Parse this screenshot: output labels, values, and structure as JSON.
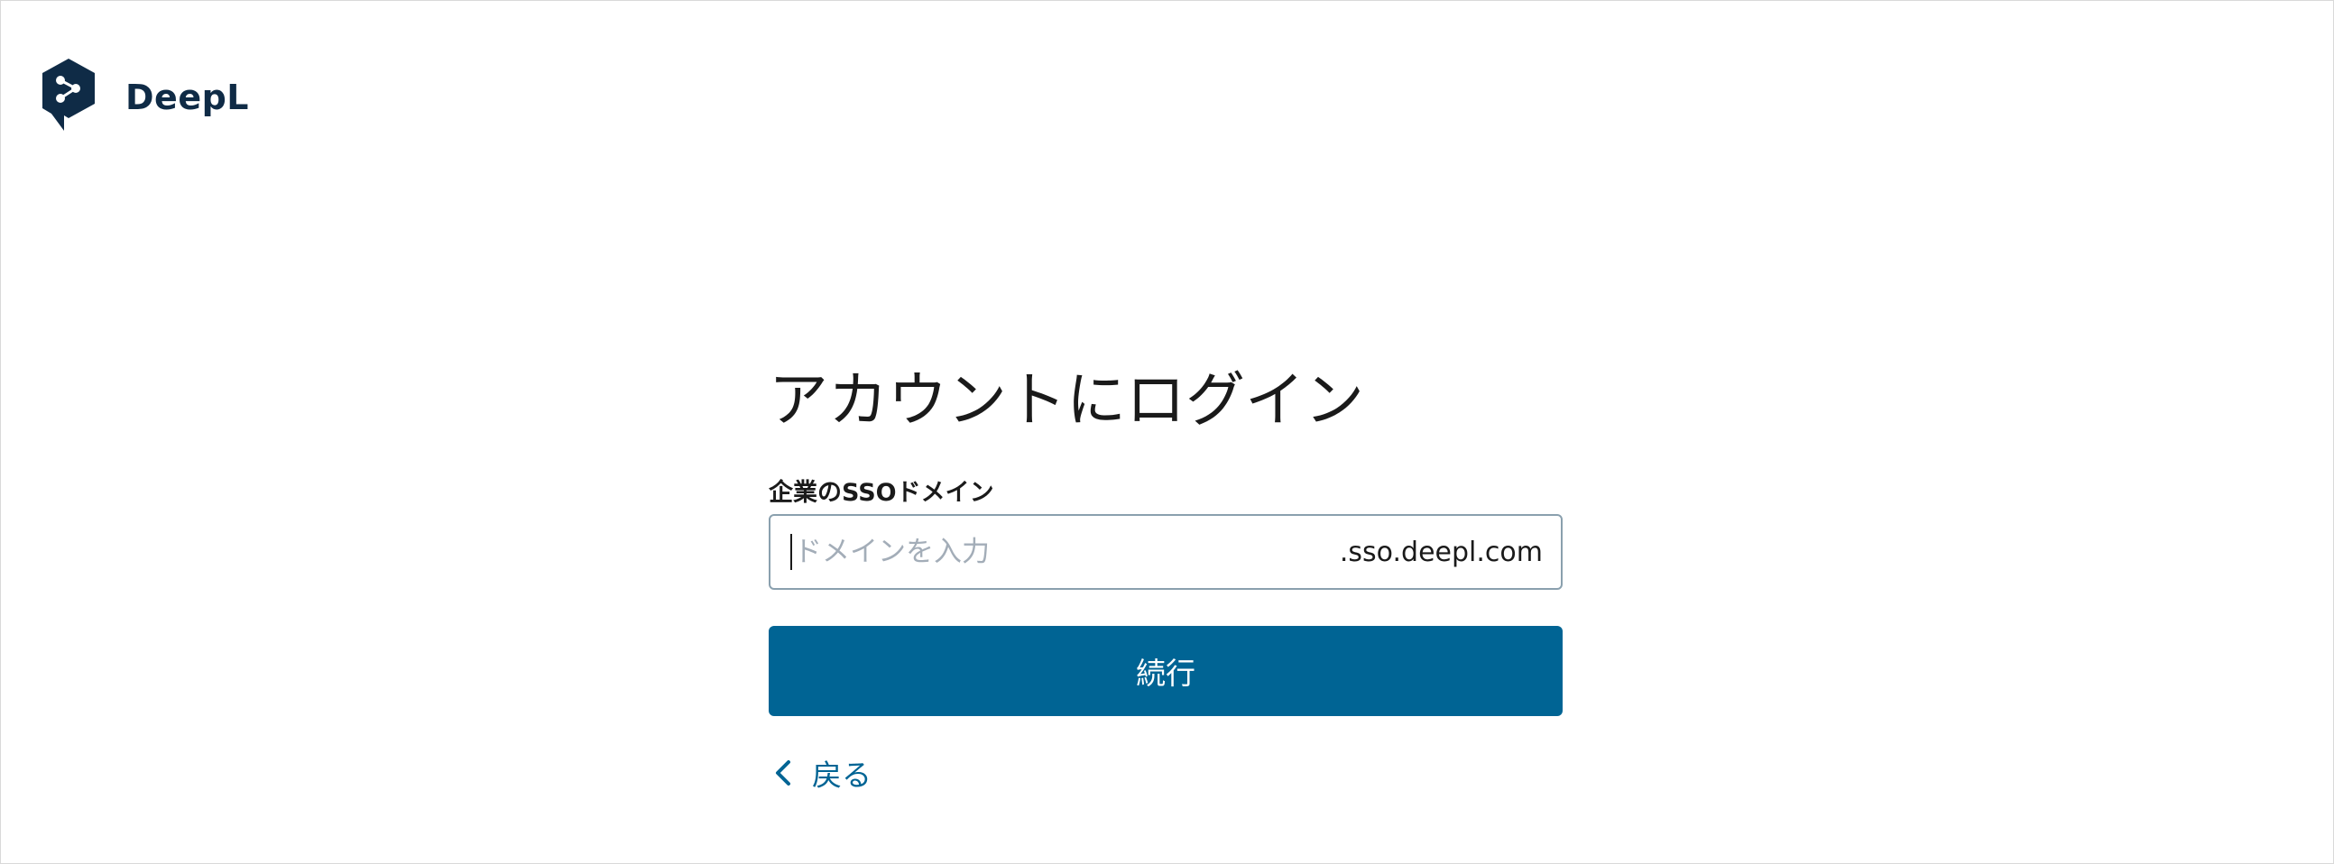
{
  "brand": {
    "name": "DeepL",
    "logo_icon": "deepl-logo-icon",
    "logo_color": "#0f2b46"
  },
  "login": {
    "title": "アカウントにログイン",
    "field_label": "企業のSSOドメイン",
    "input": {
      "value": "",
      "placeholder": "ドメインを入力",
      "suffix": ".sso.deepl.com"
    },
    "continue_label": "続行",
    "back_label": "戻る",
    "back_icon": "chevron-left-icon"
  },
  "colors": {
    "accent": "#006494",
    "text": "#1a1a1a",
    "input_border": "#8aa0ae",
    "placeholder": "#a3adb8"
  }
}
